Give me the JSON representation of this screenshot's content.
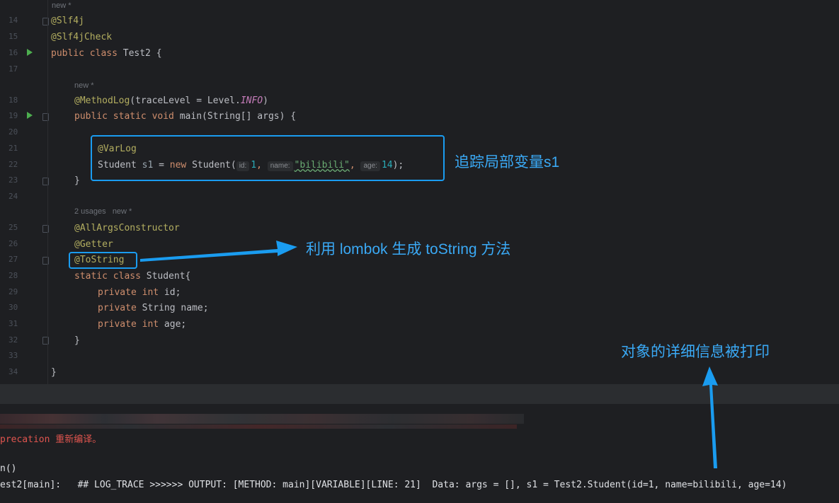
{
  "editor": {
    "hint_new_1": "new *",
    "hint_new_2": "new *",
    "hint_usages": "2 usages   new *",
    "lines": {
      "l14": "14",
      "l15": "15",
      "l16": "16",
      "l17": "17",
      "l18": "18",
      "l19": "19",
      "l20": "20",
      "l21": "21",
      "l22": "22",
      "l23": "23",
      "l24": "24",
      "l25": "25",
      "l26": "26",
      "l27": "27",
      "l28": "28",
      "l29": "29",
      "l30": "30",
      "l31": "31",
      "l32": "32",
      "l33": "33",
      "l34": "34"
    },
    "code": {
      "slf4j": "@Slf4j",
      "slf4jcheck": "@Slf4jCheck",
      "class_kw": "public class",
      "class_name": " Test2 {",
      "methodlog_ann": "@MethodLog",
      "methodlog_args": "(traceLevel = Level.",
      "methodlog_info": "INFO",
      "methodlog_end": ")",
      "main_kw": "public static void",
      "main_rest": " main(String[] args) {",
      "varlog": "@VarLog",
      "student_decl": "Student ",
      "s1": "s1",
      "assign": " = ",
      "new_kw": "new",
      "student_ctor": " Student(",
      "ph_id": "id:",
      "val_id": "1",
      "comma1": ", ",
      "ph_name": "name:",
      "val_name": "\"bilibili\"",
      "comma2": ", ",
      "ph_age": "age:",
      "val_age": "14",
      "ctor_end": ");",
      "close_brace_1": "}",
      "allargs": "@AllArgsConstructor",
      "getter": "@Getter",
      "tostring": "@ToString",
      "static_kw": "static class",
      "static_rest": " Student{",
      "priv1_kw": "private int",
      "priv1_rest": " id;",
      "priv2_kw": "private",
      "priv2_rest": " String name;",
      "priv3_kw": "private int",
      "priv3_rest": " age;",
      "close_brace_2": "}",
      "close_brace_3": "}"
    }
  },
  "callouts": {
    "track_var": "追踪局部变量s1",
    "lombok": "利用 lombok 生成 toString 方法",
    "printed": "对象的详细信息被打印"
  },
  "console": {
    "line_deprecation": "precation 重新编译。",
    "line_main": "n()",
    "line_trace_prefix": "est2[main]:   ## LOG_TRACE >>>>>> OUTPUT: [METHOD: main][VARIABLE][LINE: 21]  Data: args = [], ",
    "line_trace_result": "s1 = Test2.Student(id=1, name=bilibili, age=14)"
  },
  "colors": {
    "accent": "#1a9cf0",
    "callout_text": "#3aa9f5"
  }
}
